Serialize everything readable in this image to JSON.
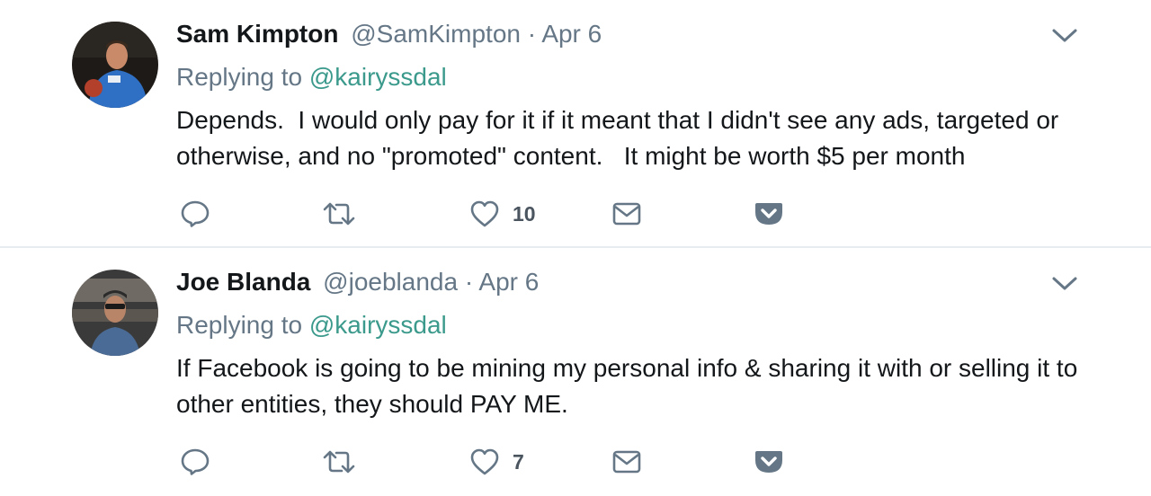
{
  "tweets": [
    {
      "name": "Sam Kimpton",
      "handle": "@SamKimpton",
      "separator": "·",
      "date": "Apr 6",
      "replying_prefix": "Replying to",
      "replying_to": "@kairyssdal",
      "text": "Depends.  I would only pay for it if it meant that I didn't see any ads, targeted or otherwise, and no \"promoted\" content.   It might be worth $5 per month",
      "like_count": "10",
      "avatar_colors": {
        "bg": "#1d1a17",
        "shirt": "#2f6fc4",
        "skin": "#c98a6a"
      }
    },
    {
      "name": "Joe Blanda",
      "handle": "@joeblanda",
      "separator": "·",
      "date": "Apr 6",
      "replying_prefix": "Replying to",
      "replying_to": "@kairyssdal",
      "text": "If Facebook is going to be mining my personal info & sharing it with or selling it to other entities, they should PAY ME.",
      "like_count": "7",
      "avatar_colors": {
        "bg": "#3a3a3a",
        "shirt": "#4a6b95",
        "skin": "#b98569"
      }
    }
  ],
  "icons": {
    "reply": "reply-icon",
    "retweet": "retweet-icon",
    "like": "heart-icon",
    "dm": "envelope-icon",
    "pocket": "pocket-icon",
    "caret": "chevron-down-icon"
  },
  "colors": {
    "name": "#14171a",
    "meta": "#657786",
    "mention": "#3b9a8c",
    "icon": "#657786",
    "divider": "#e6ecf0"
  }
}
